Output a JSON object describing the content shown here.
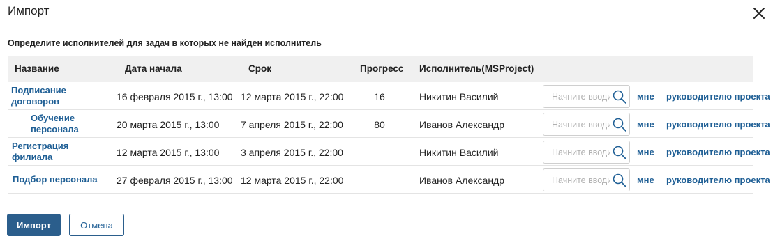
{
  "dialog": {
    "title": "Импорт",
    "subtitle": "Определите исполнителей для задач в которых не найден исполнитель"
  },
  "table": {
    "headers": {
      "name": "Название",
      "start": "Дата начала",
      "due": "Срок",
      "progress": "Прогресс",
      "executor": "Исполнитель(MSProject)"
    },
    "rows": [
      {
        "name": "Подписание договоров",
        "start": "16 февраля 2015 г., 13:00",
        "due": "12 марта 2015 г., 22:00",
        "progress": "16",
        "executor": "Никитин Василий",
        "placeholder": "Начните вводить",
        "me": "мне",
        "pm": "руководителю проекта"
      },
      {
        "name": "Обучение персонала",
        "start": "20 марта 2015 г., 13:00",
        "due": "7 апреля 2015 г., 22:00",
        "progress": "80",
        "executor": "Иванов Александр",
        "placeholder": "Начните вводить",
        "me": "мне",
        "pm": "руководителю проекта"
      },
      {
        "name": "Регистрация филиала",
        "start": "12 марта 2015 г., 13:00",
        "due": "3 апреля 2015 г., 22:00",
        "progress": "",
        "executor": "Никитин Василий",
        "placeholder": "Начните вводить",
        "me": "мне",
        "pm": "руководителю проекта"
      },
      {
        "name": "Подбор персонала",
        "start": "27 февраля 2015 г., 13:00",
        "due": "12 марта 2015 г., 22:00",
        "progress": "",
        "executor": "Иванов Александр",
        "placeholder": "Начните вводить",
        "me": "мне",
        "pm": "руководителю проекта"
      }
    ]
  },
  "buttons": {
    "import": "Импорт",
    "cancel": "Отмена"
  },
  "icons": {
    "close": "close-icon",
    "search": "search-icon"
  },
  "colors": {
    "link": "#1f5f95",
    "primary": "#2b5e8c",
    "header_bg": "#f0f0f0"
  }
}
